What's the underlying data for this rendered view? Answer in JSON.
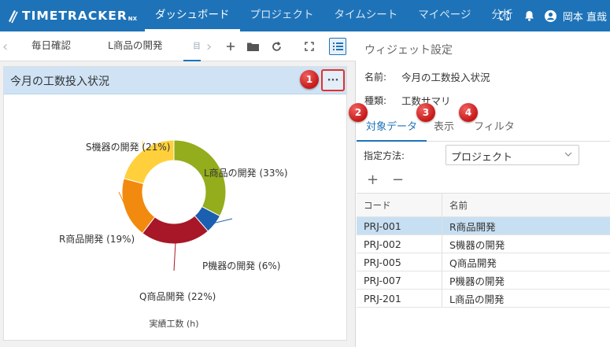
{
  "app": {
    "logo": "TIMETRACKER",
    "logo_suffix": "NX",
    "nav": [
      {
        "label": "ダッシュボード",
        "active": true
      },
      {
        "label": "プロジェクト",
        "active": false
      },
      {
        "label": "タイムシート",
        "active": false
      },
      {
        "label": "マイページ",
        "active": false
      },
      {
        "label": "分析",
        "active": false
      }
    ],
    "user": "岡本 直哉"
  },
  "tabs": {
    "items": [
      "毎日確認",
      "L商品の開発"
    ],
    "stub": "目"
  },
  "widget": {
    "title": "今月の工数投入状況",
    "more_label": "···"
  },
  "chart_data": {
    "type": "pie",
    "donut": true,
    "xlabel": "実績工数 (h)",
    "slices": [
      {
        "label": "L商品の開発 (33%)",
        "value": 33,
        "color": "#93ad1c"
      },
      {
        "label": "P機器の開発 (6%)",
        "value": 6,
        "color": "#1b5fb0"
      },
      {
        "label": "Q商品開発 (22%)",
        "value": 22,
        "color": "#a81727"
      },
      {
        "label": "R商品開発 (19%)",
        "value": 19,
        "color": "#f28a0f"
      },
      {
        "label": "S機器の開発 (21%)",
        "value": 21,
        "color": "#ffd03c"
      }
    ]
  },
  "settings": {
    "title": "ウィジェット設定",
    "name_label": "名前:",
    "name_value": "今月の工数投入状況",
    "type_label": "種類:",
    "type_value": "工数サマリ",
    "tabs": [
      {
        "label": "対象データ",
        "active": true
      },
      {
        "label": "表示",
        "active": false
      },
      {
        "label": "フィルタ",
        "active": false
      }
    ],
    "method_label": "指定方法:",
    "method_value": "プロジェクト",
    "add_label": "+",
    "remove_label": "−",
    "columns": {
      "code": "コード",
      "name": "名前"
    },
    "rows": [
      {
        "code": "PRJ-001",
        "name": "R商品開発",
        "selected": true
      },
      {
        "code": "PRJ-002",
        "name": "S機器の開発",
        "selected": false
      },
      {
        "code": "PRJ-005",
        "name": "Q商品開発",
        "selected": false
      },
      {
        "code": "PRJ-007",
        "name": "P機器の開発",
        "selected": false
      },
      {
        "code": "PRJ-201",
        "name": "L商品の開発",
        "selected": false
      }
    ]
  },
  "badges": [
    "1",
    "2",
    "3",
    "4"
  ]
}
